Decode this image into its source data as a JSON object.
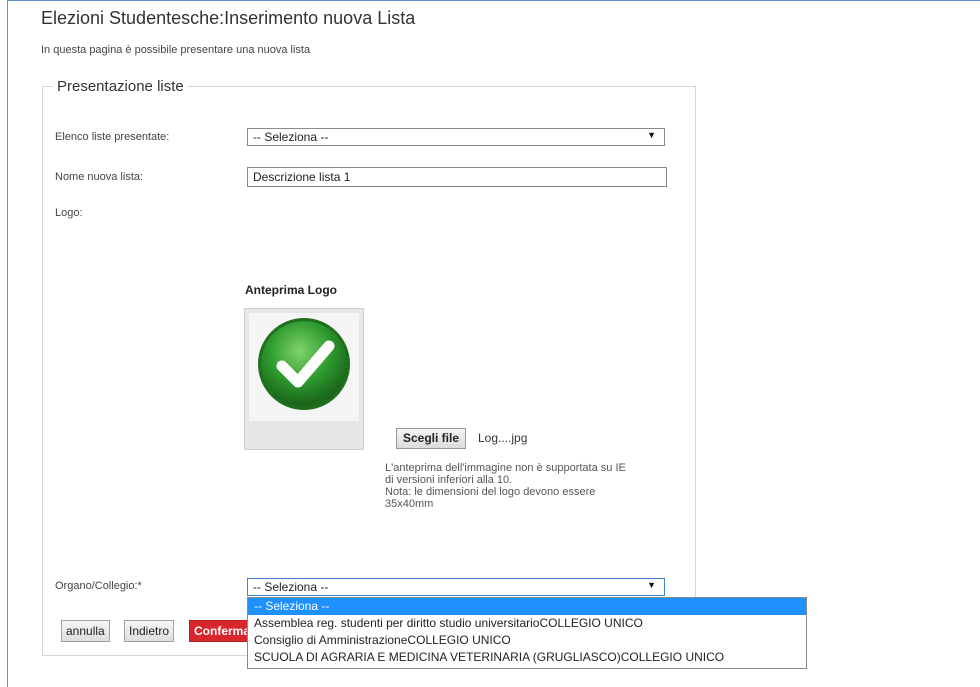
{
  "header": {
    "title": "Elezioni Studentesche:Inserimento nuova Lista",
    "subtitle": "In questa pagina è possibile presentare una nuova lista"
  },
  "form": {
    "legend": "Presentazione liste",
    "elenco_label": "Elenco liste presentate:",
    "elenco_value": "-- Seleziona --",
    "nome_label": "Nome nuova lista:",
    "nome_value": "Descrizione lista 1",
    "logo_label": "Logo:",
    "preview_label": "Anteprima Logo",
    "file_button": "Scegli file",
    "file_name": "Log....jpg",
    "note_lines": [
      "L'anteprima dell'immagine non è supportata su IE",
      "di versioni inferiori alla 10.",
      "Nota: le dimensioni del logo devono essere",
      "35x40mm"
    ],
    "organo_label": "Organo/Collegio:*",
    "organo_value": "-- Seleziona --"
  },
  "dropdown": {
    "options": [
      "-- Seleziona --",
      "Assemblea reg. studenti per diritto studio universitarioCOLLEGIO UNICO",
      "Consiglio di AmministrazioneCOLLEGIO UNICO",
      "SCUOLA DI AGRARIA E MEDICINA VETERINARIA (GRUGLIASCO)COLLEGIO UNICO"
    ],
    "selected_index": 0
  },
  "buttons": {
    "annulla": "annulla",
    "indietro": "Indietro",
    "conferma": "Conferma"
  },
  "icons": {
    "arrow": "dropdown-arrow-icon",
    "logo": "green-checkmark-icon"
  },
  "colors": {
    "confirm_button": "#d9262c",
    "selection_highlight": "#1e90ff",
    "logo_green": "#2e9a2e"
  }
}
